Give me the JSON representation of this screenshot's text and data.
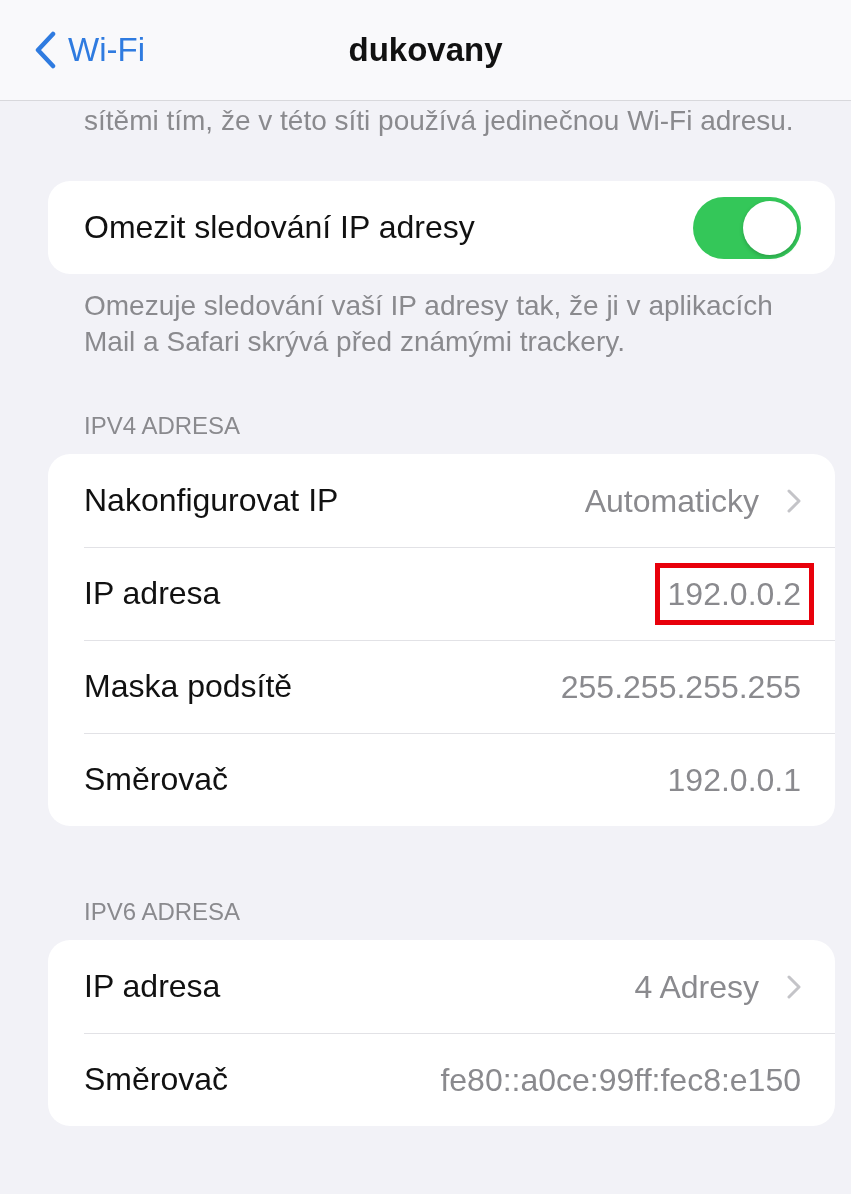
{
  "nav": {
    "back": "Wi-Fi",
    "title": "dukovany"
  },
  "intro_text": "sítěmi tím, že v této síti používá jedinečnou Wi-Fi adresu.",
  "toggle_row": {
    "label": "Omezit sledování IP adresy",
    "on": true
  },
  "toggle_footer": "Omezuje sledování vaší IP adresy tak, že ji v aplikacích Mail a Safari skrývá před známými trackery.",
  "sections": [
    {
      "header": "IPV4 ADRESA",
      "rows": [
        {
          "label": "Nakonfigurovat IP",
          "value": "Automaticky",
          "chevron": true,
          "highlighted": false
        },
        {
          "label": "IP adresa",
          "value": "192.0.0.2",
          "chevron": false,
          "highlighted": true
        },
        {
          "label": "Maska podsítě",
          "value": "255.255.255.255",
          "chevron": false,
          "highlighted": false
        },
        {
          "label": "Směrovač",
          "value": "192.0.0.1",
          "chevron": false,
          "highlighted": false
        }
      ]
    },
    {
      "header": "IPV6 ADRESA",
      "rows": [
        {
          "label": "IP adresa",
          "value": "4 Adresy",
          "chevron": true,
          "highlighted": false
        },
        {
          "label": "Směrovač",
          "value": "fe80::a0ce:99ff:fec8:e150",
          "chevron": false,
          "highlighted": false
        }
      ]
    }
  ]
}
